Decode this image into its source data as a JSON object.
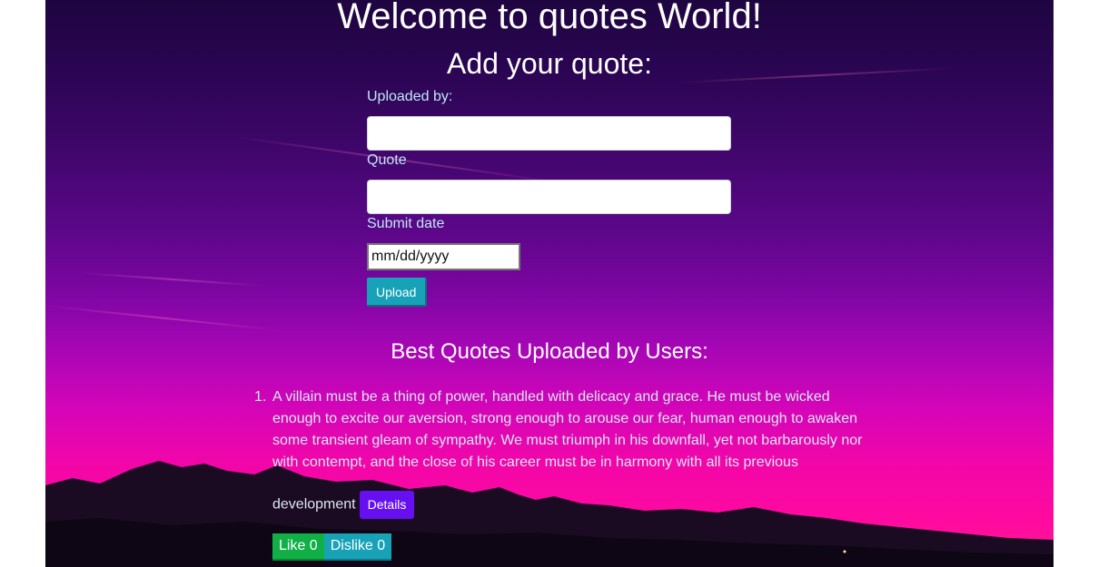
{
  "header": {
    "title": "Welcome to quotes World!",
    "subtitle": "Add your quote:"
  },
  "form": {
    "uploaded_by_label": "Uploaded by:",
    "uploaded_by_value": "",
    "quote_label": "Quote",
    "quote_value": "",
    "date_label": "Submit date",
    "date_value": "mm/dd/yyyy",
    "upload_label": "Upload"
  },
  "quotes_section": {
    "heading": "Best Quotes Uploaded by Users:",
    "items": [
      {
        "number": "1.",
        "text_main": "A villain must be a thing of power, handled with delicacy and grace. He must be wicked enough to excite our aversion, strong enough to arouse our fear, human enough to awaken some transient gleam of sympathy. We must triumph in his downfall, yet not barbarously nor with contempt, and the close of his career must be in harmony with all its previous",
        "text_last": "development",
        "details_label": "Details",
        "like_label": "Like 0",
        "dislike_label": "Dislike 0"
      }
    ]
  },
  "colors": {
    "page_background": "#ffffff",
    "upload_button": "#17a2b8",
    "details_button": "#6610f2",
    "like_button": "#10b046",
    "dislike_button": "#17a2b8",
    "label_text": "#bfe8f5"
  }
}
